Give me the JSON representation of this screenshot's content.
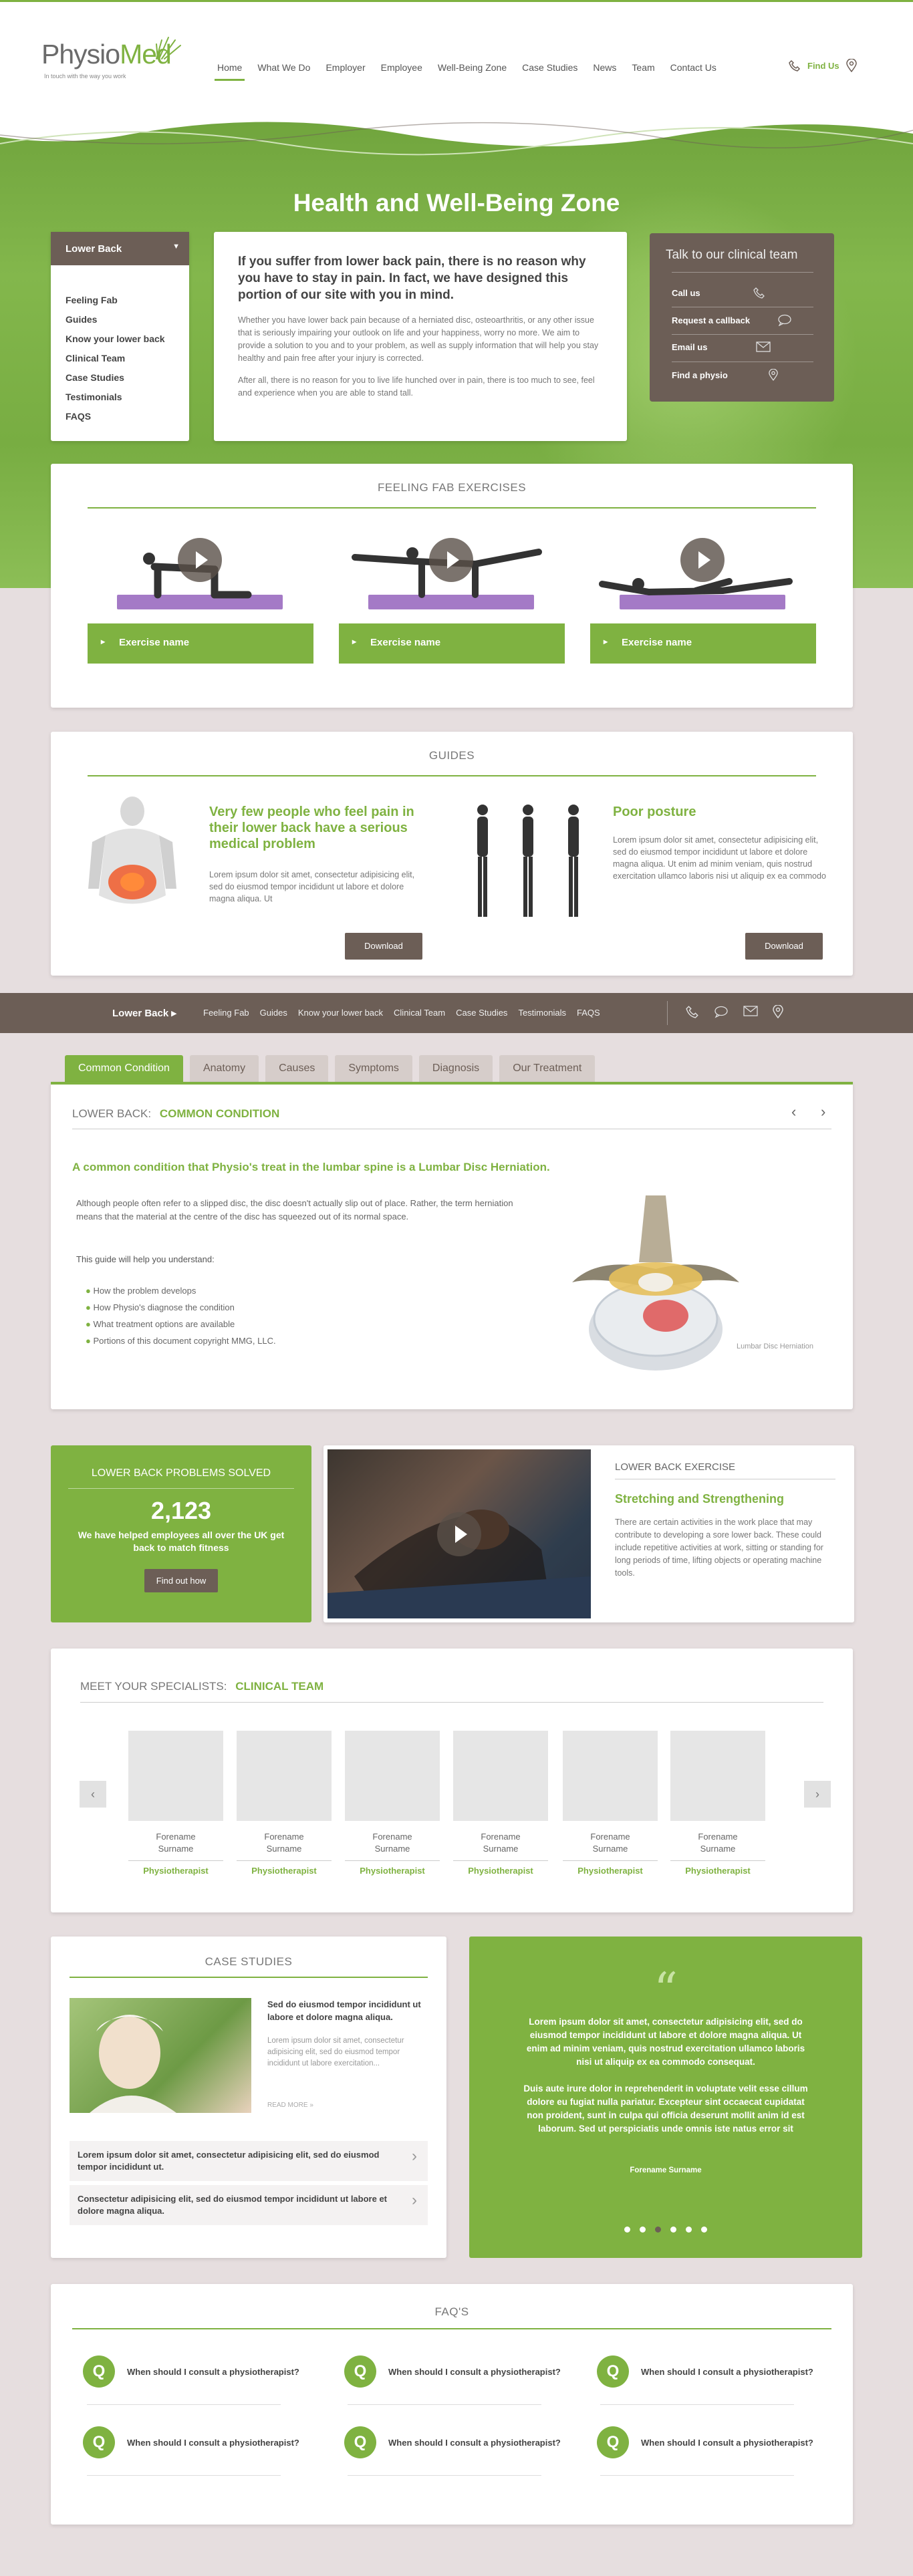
{
  "header": {
    "logo_part1": "Physio",
    "logo_part2": "Med",
    "tagline": "In touch with the way you work",
    "nav": [
      "Home",
      "What We Do",
      "Employer",
      "Employee",
      "Well-Being Zone",
      "Case Studies",
      "News",
      "Team",
      "Contact Us"
    ],
    "find_us": "Find Us"
  },
  "hero": {
    "title": "Health and Well-Being Zone"
  },
  "sidebar": {
    "current": "Lower Back",
    "items": [
      "Feeling Fab",
      "Guides",
      "Know your lower back",
      "Clinical Team",
      "Case Studies",
      "Testimonials",
      "FAQS"
    ]
  },
  "intro": {
    "heading": "If you suffer from lower back pain, there is no reason why you have to stay in pain. In fact, we have designed this portion of our site with you in mind.",
    "para1": "Whether you have lower back pain because of a herniated disc, osteoarthritis, or any other issue that is seriously impairing your outlook on life and your happiness, worry no more. We aim to provide a solution to you and to your problem, as well as supply information that will help you stay healthy and pain free after your injury is corrected.",
    "para2": "After all, there is no reason for you to live life hunched over in pain, there is too much to see, feel and experience when you are able to stand tall."
  },
  "contact": {
    "title": "Talk to our clinical team",
    "rows": [
      {
        "label": "Call us",
        "icon": "phone-icon"
      },
      {
        "label": "Request a callback",
        "icon": "chat-icon"
      },
      {
        "label": "Email us",
        "icon": "envelope-icon"
      },
      {
        "label": "Find a physio",
        "icon": "map-pin-icon"
      }
    ]
  },
  "exercises": {
    "title": "FEELING FAB EXERCISES",
    "items": [
      "Exercise name",
      "Exercise name",
      "Exercise name"
    ]
  },
  "guides": {
    "title": "GUIDES",
    "items": [
      {
        "title": "Very few people who feel pain in their lower back have a serious medical problem",
        "text": "Lorem ipsum dolor sit amet, consectetur adipisicing elit, sed do eiusmod tempor incididunt ut labore et dolore magna aliqua. Ut",
        "button": "Download"
      },
      {
        "title": "Poor posture",
        "text": "Lorem ipsum dolor sit amet, consectetur adipisicing elit, sed do eiusmod tempor incididunt ut labore et dolore magna aliqua. Ut enim ad minim veniam, quis nostrud exercitation ullamco laboris nisi ut aliquip ex ea commodo",
        "button": "Download"
      }
    ]
  },
  "subnav": {
    "current": "Lower Back",
    "links": [
      "Feeling Fab",
      "Guides",
      "Know your lower back",
      "Clinical Team",
      "Case Studies",
      "Testimonials",
      "FAQS"
    ]
  },
  "tabs": [
    "Common Condition",
    "Anatomy",
    "Causes",
    "Symptoms",
    "Diagnosis",
    "Our Treatment"
  ],
  "condition": {
    "label": "LOWER BACK:",
    "label_green": "COMMON CONDITION",
    "headline": "A common condition that Physio's treat in the lumbar spine is a Lumbar Disc Herniation.",
    "para": "Although people often refer to a slipped disc, the disc doesn't actually slip out of place. Rather, the term herniation means that the material at the centre of the disc has squeezed out of its normal space.",
    "guide_intro": "This guide will help you understand:",
    "bullets": [
      "How the problem develops",
      "How Physio's diagnose the condition",
      "What treatment options are available",
      "Portions of this document copyright MMG, LLC."
    ],
    "image_caption": "Lumbar Disc Herniation"
  },
  "solved": {
    "title": "LOWER BACK PROBLEMS SOLVED",
    "count": "2,123",
    "text": "We have helped employees all over the UK get back to match fitness",
    "button": "Find out how"
  },
  "lb_exercise": {
    "title": "LOWER BACK EXERCISE",
    "heading": "Stretching and Strengthening",
    "text": "There are certain activities in the work place that may contribute to developing a sore lower back. These could include repetitive activities at work, sitting or standing for long periods of time, lifting objects or operating machine tools."
  },
  "team": {
    "title": "MEET YOUR SPECIALISTS:",
    "title_green": "CLINICAL TEAM",
    "members": [
      {
        "name1": "Forename",
        "name2": "Surname",
        "role": "Physiotherapist"
      },
      {
        "name1": "Forename",
        "name2": "Surname",
        "role": "Physiotherapist"
      },
      {
        "name1": "Forename",
        "name2": "Surname",
        "role": "Physiotherapist"
      },
      {
        "name1": "Forename",
        "name2": "Surname",
        "role": "Physiotherapist"
      },
      {
        "name1": "Forename",
        "name2": "Surname",
        "role": "Physiotherapist"
      },
      {
        "name1": "Forename",
        "name2": "Surname",
        "role": "Physiotherapist"
      }
    ]
  },
  "cases": {
    "title": "CASE STUDIES",
    "feature_title": "Sed do eiusmod tempor incididunt ut labore et dolore magna aliqua.",
    "feature_text": "Lorem ipsum dolor sit amet, consectetur adipisicing elit, sed do eiusmod tempor incididunt ut labore exercitation...",
    "read_more": "READ MORE »",
    "rows": [
      "Lorem ipsum dolor sit amet, consectetur adipisicing elit, sed do eiusmod tempor incididunt ut.",
      "Consectetur adipisicing elit, sed do eiusmod tempor incididunt ut labore et dolore magna aliqua."
    ]
  },
  "testimonial": {
    "mark": "“",
    "p1": "Lorem ipsum dolor sit amet, consectetur adipisicing elit, sed do eiusmod tempor incididunt ut labore et dolore magna aliqua. Ut enim ad minim veniam, quis nostrud exercitation ullamco laboris nisi ut aliquip ex ea commodo consequat.",
    "p2": "Duis aute irure dolor in reprehenderit in voluptate velit esse cillum dolore eu fugiat nulla pariatur. Excepteur sint occaecat cupidatat non proident, sunt in culpa qui officia deserunt mollit anim id est laborum. Sed ut perspiciatis unde omnis iste natus error sit",
    "author": "Forename Surname",
    "slide_count": 6,
    "active_slide": 3
  },
  "faq": {
    "title": "FAQ'S",
    "q_letter": "Q",
    "items": [
      "When should I consult a physiotherapist?",
      "When should I consult a physiotherapist?",
      "When should I consult a physiotherapist?",
      "When should I consult a physiotherapist?",
      "When should I consult a physiotherapist?",
      "When should I consult a physiotherapist?"
    ]
  },
  "colors": {
    "brand_green": "#7fb241",
    "brown": "#6c5e56",
    "page_bg": "#e6dedf"
  }
}
